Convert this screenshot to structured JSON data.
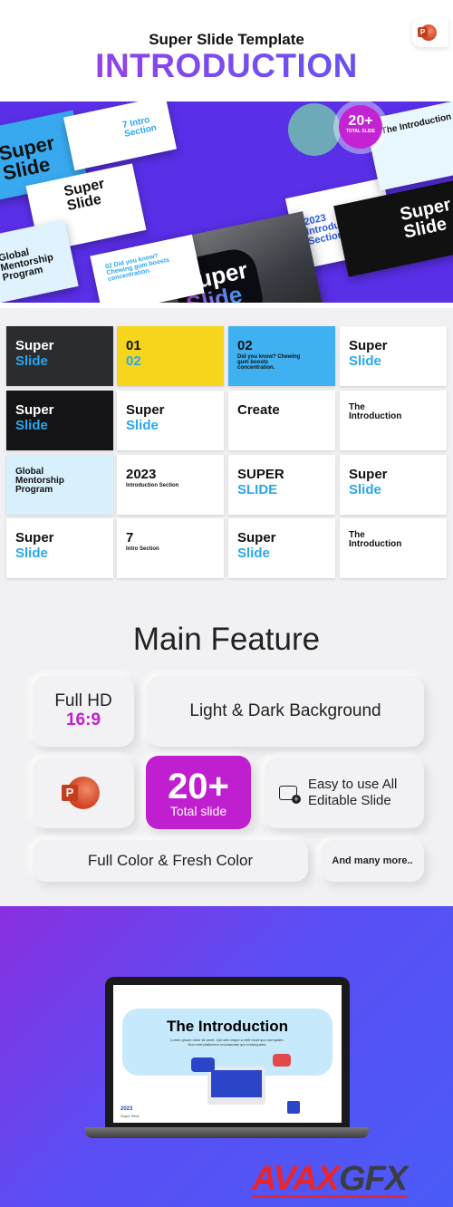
{
  "header": {
    "subtitle": "Super Slide Template",
    "title": "INTRODUCTION",
    "app_icon": "powerpoint-icon"
  },
  "hero": {
    "main_slide": {
      "line1": "Super",
      "line2": "Slide"
    },
    "badge": {
      "count": "20+",
      "label": "TOTAL SLIDE"
    },
    "slides": [
      "Super Slide",
      "7 Intro Section",
      "Super Slide",
      "Global Mentorship Program",
      "02 Did you know? Chewing gum boosts concentration.",
      "2023 Introduction Section",
      "Super Slide",
      "The Introduction"
    ]
  },
  "thumbnails": [
    {
      "a": "Super",
      "b": "Slide",
      "bg": "#2b2c30",
      "fg": "#ffffff"
    },
    {
      "a": "01",
      "b": "02",
      "bg": "#f5d61c",
      "fg": "#111111"
    },
    {
      "a": "02",
      "b": "Did you know? Chewing gum boosts concentration.",
      "bg": "#3fb1f0",
      "fg": "#111111"
    },
    {
      "a": "Super",
      "b": "Slide",
      "bg": "#ffffff",
      "fg": "#111111"
    },
    {
      "a": "Super",
      "b": "Slide",
      "bg": "#141416",
      "fg": "#ffffff"
    },
    {
      "a": "Super",
      "b": "Slide",
      "bg": "#ffffff",
      "fg": "#111111"
    },
    {
      "a": "Create",
      "b": "",
      "bg": "#ffffff",
      "fg": "#111111"
    },
    {
      "a": "The Introduction",
      "b": "",
      "bg": "#ffffff",
      "fg": "#111111"
    },
    {
      "a": "Global Mentorship Program",
      "b": "",
      "bg": "#d8f0fc",
      "fg": "#111111"
    },
    {
      "a": "2023",
      "b": "Introduction Section",
      "bg": "#ffffff",
      "fg": "#111111"
    },
    {
      "a": "SUPER",
      "b": "SLIDE",
      "bg": "#ffffff",
      "fg": "#111111"
    },
    {
      "a": "Super",
      "b": "Slide",
      "bg": "#ffffff",
      "fg": "#111111"
    },
    {
      "a": "Super",
      "b": "Slide",
      "bg": "#ffffff",
      "fg": "#111111"
    },
    {
      "a": "7",
      "b": "Intro Section",
      "bg": "#ffffff",
      "fg": "#111111"
    },
    {
      "a": "Super",
      "b": "Slide",
      "bg": "#ffffff",
      "fg": "#111111"
    },
    {
      "a": "The Introduction",
      "b": "",
      "bg": "#ffffff",
      "fg": "#111111"
    }
  ],
  "features": {
    "title": "Main Feature",
    "full_hd": "Full HD",
    "ratio": "16:9",
    "background": "Light & Dark Background",
    "count": "20+",
    "count_label": "Total slide",
    "editable_line1": "Easy to use All",
    "editable_line2": "Editable Slide",
    "color": "Full Color & Fresh Color",
    "more": "And many more..",
    "accent": "#c01fcf"
  },
  "laptop": {
    "slide_title": "The Introduction",
    "slide_text": "Lorem ipsum dolor sit amet. Qui sint neque a velit modi quo numquam. Non exercitationem recusandae qui consequatur.",
    "year": "2023",
    "footer": "Super Slide"
  },
  "watermark": {
    "text1": "AVAX",
    "text2": "GFX"
  }
}
